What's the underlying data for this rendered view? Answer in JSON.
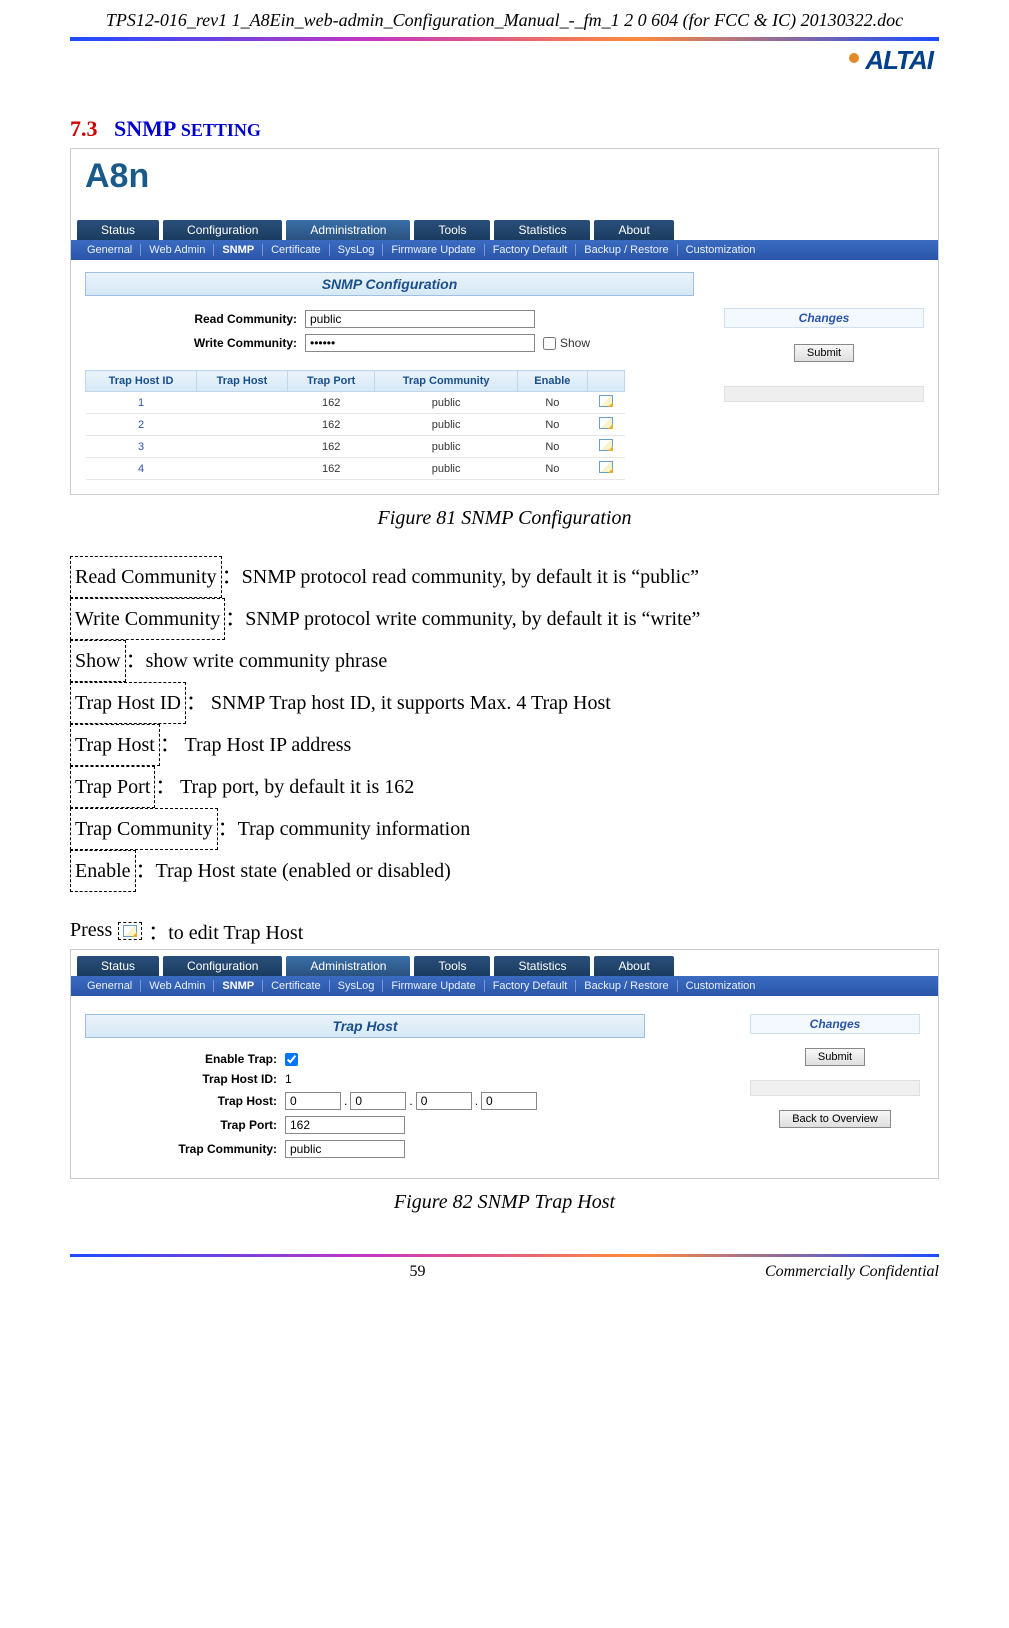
{
  "doc": {
    "header_title": "TPS12-016_rev1 1_A8Ein_web-admin_Configuration_Manual_-_fm_1 2 0 604 (for FCC & IC) 20130322.doc",
    "logo_text": "ALTAI",
    "page_number": "59",
    "confidential": "Commercially Confidential"
  },
  "section": {
    "number": "7.3",
    "title_upper": "SNMP",
    "title_rest": " SETTING"
  },
  "fig81": {
    "brand": "A8n",
    "tabs": [
      "Status",
      "Configuration",
      "Administration",
      "Tools",
      "Statistics",
      "About"
    ],
    "subnav": [
      "Genernal",
      "Web Admin",
      "SNMP",
      "Certificate",
      "SysLog",
      "Firmware Update",
      "Factory Default",
      "Backup / Restore",
      "Customization"
    ],
    "panel_title": "SNMP Configuration",
    "read_label": "Read Community:",
    "read_value": "public",
    "write_label": "Write Community:",
    "write_value": "••••••",
    "show_label": "Show",
    "changes_label": "Changes",
    "submit_label": "Submit",
    "columns": [
      "Trap Host ID",
      "Trap Host",
      "Trap Port",
      "Trap Community",
      "Enable",
      ""
    ],
    "rows": [
      {
        "id": "1",
        "host": "",
        "port": "162",
        "community": "public",
        "enable": "No"
      },
      {
        "id": "2",
        "host": "",
        "port": "162",
        "community": "public",
        "enable": "No"
      },
      {
        "id": "3",
        "host": "",
        "port": "162",
        "community": "public",
        "enable": "No"
      },
      {
        "id": "4",
        "host": "",
        "port": "162",
        "community": "public",
        "enable": "No"
      }
    ],
    "caption": "Figure 81 SNMP Configuration"
  },
  "defs": {
    "items": [
      {
        "term": "Read Community",
        "desc": "：SNMP protocol read community, by default it is “public”"
      },
      {
        "term": "Write Community",
        "desc": "：SNMP protocol write community, by default it is “write”"
      },
      {
        "term": "Show",
        "desc": "：show write community phrase"
      },
      {
        "term": "Trap Host ID",
        "desc": "： SNMP Trap host ID, it supports Max. 4 Trap Host"
      },
      {
        "term": "Trap Host",
        "desc": "： Trap Host IP address"
      },
      {
        "term": "Trap Port",
        "desc": "： Trap port, by default it is 162"
      },
      {
        "term": "Trap Community",
        "desc": "：Trap community information"
      },
      {
        "term": "Enable",
        "desc": "：Trap Host state (enabled or disabled)"
      }
    ]
  },
  "press_line": {
    "prefix": "Press ",
    "suffix": "：to edit Trap Host"
  },
  "fig82": {
    "tabs": [
      "Status",
      "Configuration",
      "Administration",
      "Tools",
      "Statistics",
      "About"
    ],
    "subnav": [
      "Genernal",
      "Web Admin",
      "SNMP",
      "Certificate",
      "SysLog",
      "Firmware Update",
      "Factory Default",
      "Backup / Restore",
      "Customization"
    ],
    "panel_title": "Trap Host",
    "enable_label": "Enable Trap:",
    "hostid_label": "Trap Host ID:",
    "hostid_value": "1",
    "traphost_label": "Trap Host:",
    "ip": [
      "0",
      "0",
      "0",
      "0"
    ],
    "trap_port_label": "Trap Port:",
    "trap_port_value": "162",
    "trap_comm_label": "Trap Community:",
    "trap_comm_value": "public",
    "changes_label": "Changes",
    "submit_label": "Submit",
    "back_label": "Back to Overview",
    "caption": "Figure 82 SNMP Trap Host"
  }
}
